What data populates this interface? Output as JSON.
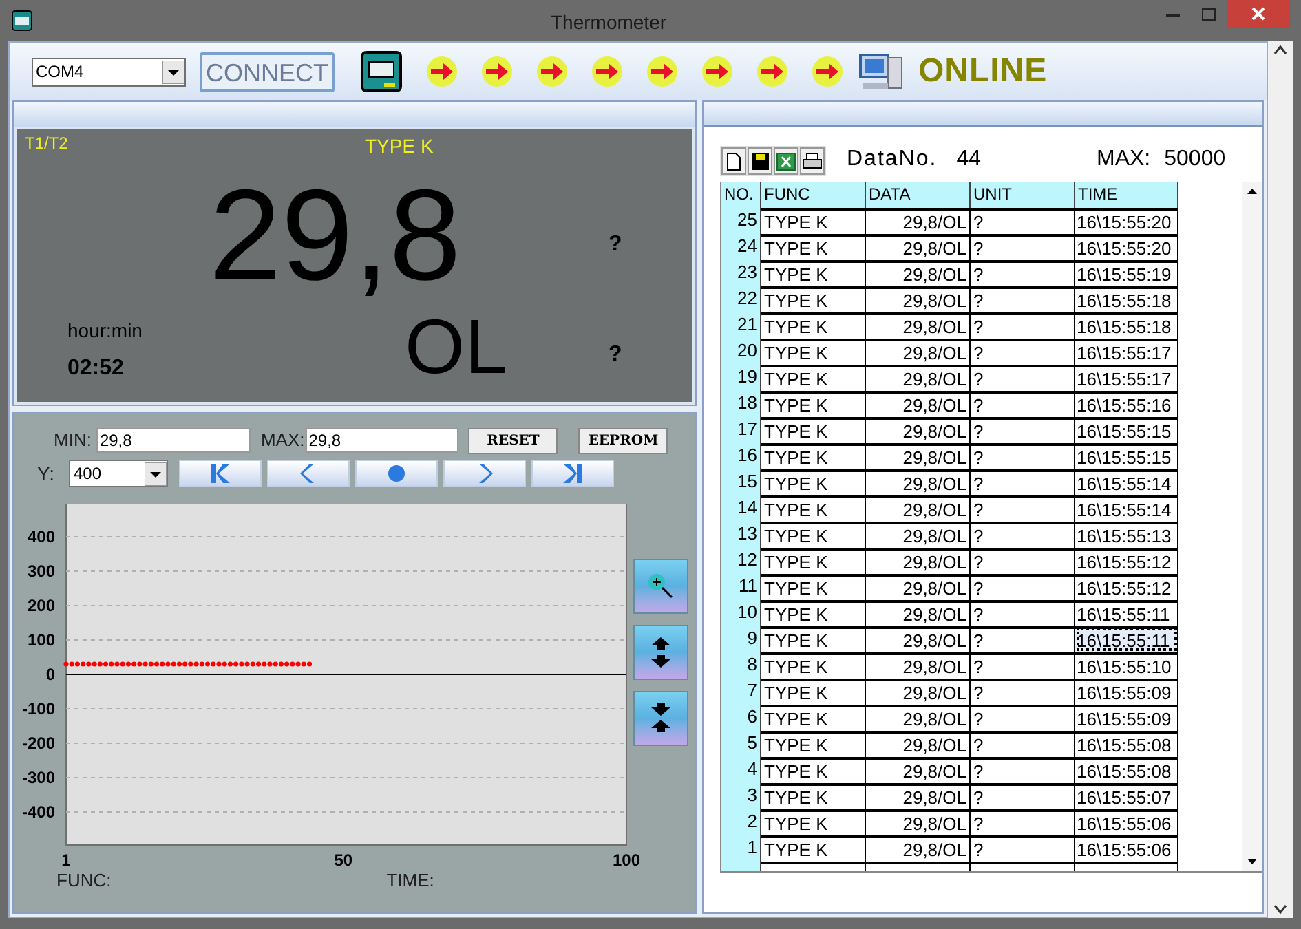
{
  "window": {
    "title": "Thermometer"
  },
  "toolbar": {
    "port": "COM4",
    "connect": "CONNECT",
    "status": "ONLINE"
  },
  "display": {
    "mode": "T1/T2",
    "func": "TYPE K",
    "main_value": "29,8",
    "main_unit": "?",
    "sub_value": "OL",
    "sub_unit": "?",
    "time_label": "hour:min",
    "time": "02:52"
  },
  "graph": {
    "min_label": "MIN:",
    "min": "29,8",
    "max_label": "MAX:",
    "max": "29,8",
    "reset": "RESET",
    "eeprom": "EEPROM",
    "y_label": "Y:",
    "y_range": "400",
    "func_label": "FUNC:",
    "time_label": "TIME:",
    "chart_data": {
      "type": "scatter",
      "grid": true,
      "x": [
        1,
        2,
        3,
        4,
        5,
        6,
        7,
        8,
        9,
        10,
        11,
        12,
        13,
        14,
        15,
        16,
        17,
        18,
        19,
        20,
        21,
        22,
        23,
        24,
        25,
        26,
        27,
        28,
        29,
        30,
        31,
        32,
        33,
        34,
        35,
        36,
        37,
        38,
        39,
        40,
        41,
        42,
        43,
        44
      ],
      "xlim": [
        1,
        100
      ],
      "ylim": [
        -496,
        496
      ],
      "xticks": [
        1,
        50,
        100
      ],
      "yticks": [
        400,
        300,
        200,
        100,
        0,
        -100,
        -200,
        -300,
        -400
      ],
      "series": [
        {
          "color": "#ff0000",
          "values": [
            30,
            30,
            30,
            30,
            30,
            30,
            30,
            30,
            30,
            30,
            30,
            30,
            30,
            30,
            30,
            30,
            30,
            30,
            30,
            30,
            30,
            30,
            30,
            30,
            30,
            30,
            30,
            30,
            30,
            30,
            30,
            30,
            30,
            30,
            30,
            30,
            30,
            30,
            30,
            30,
            30,
            30,
            30,
            30
          ]
        }
      ]
    }
  },
  "data_panel": {
    "data_no_label": "DataNo.",
    "data_no": "44",
    "max_label": "MAX:",
    "max": "50000"
  },
  "table": {
    "columns": [
      "NO.",
      "FUNC",
      "DATA",
      "UNIT",
      "TIME"
    ],
    "rows": [
      {
        "cells": [
          "25",
          "TYPE K",
          "29,8/OL",
          "?",
          "16\\15:55:20"
        ],
        "selected": false
      },
      {
        "cells": [
          "24",
          "TYPE K",
          "29,8/OL",
          "?",
          "16\\15:55:20"
        ],
        "selected": false
      },
      {
        "cells": [
          "23",
          "TYPE K",
          "29,8/OL",
          "?",
          "16\\15:55:19"
        ],
        "selected": false
      },
      {
        "cells": [
          "22",
          "TYPE K",
          "29,8/OL",
          "?",
          "16\\15:55:18"
        ],
        "selected": false
      },
      {
        "cells": [
          "21",
          "TYPE K",
          "29,8/OL",
          "?",
          "16\\15:55:18"
        ],
        "selected": false
      },
      {
        "cells": [
          "20",
          "TYPE K",
          "29,8/OL",
          "?",
          "16\\15:55:17"
        ],
        "selected": false
      },
      {
        "cells": [
          "19",
          "TYPE K",
          "29,8/OL",
          "?",
          "16\\15:55:17"
        ],
        "selected": false
      },
      {
        "cells": [
          "18",
          "TYPE K",
          "29,8/OL",
          "?",
          "16\\15:55:16"
        ],
        "selected": false
      },
      {
        "cells": [
          "17",
          "TYPE K",
          "29,8/OL",
          "?",
          "16\\15:55:15"
        ],
        "selected": false
      },
      {
        "cells": [
          "16",
          "TYPE K",
          "29,8/OL",
          "?",
          "16\\15:55:15"
        ],
        "selected": false
      },
      {
        "cells": [
          "15",
          "TYPE K",
          "29,8/OL",
          "?",
          "16\\15:55:14"
        ],
        "selected": false
      },
      {
        "cells": [
          "14",
          "TYPE K",
          "29,8/OL",
          "?",
          "16\\15:55:14"
        ],
        "selected": false
      },
      {
        "cells": [
          "13",
          "TYPE K",
          "29,8/OL",
          "?",
          "16\\15:55:13"
        ],
        "selected": false
      },
      {
        "cells": [
          "12",
          "TYPE K",
          "29,8/OL",
          "?",
          "16\\15:55:12"
        ],
        "selected": false
      },
      {
        "cells": [
          "11",
          "TYPE K",
          "29,8/OL",
          "?",
          "16\\15:55:12"
        ],
        "selected": false
      },
      {
        "cells": [
          "10",
          "TYPE K",
          "29,8/OL",
          "?",
          "16\\15:55:11"
        ],
        "selected": false
      },
      {
        "cells": [
          "9",
          "TYPE K",
          "29,8/OL",
          "?",
          "16\\15:55:11"
        ],
        "selected": true
      },
      {
        "cells": [
          "8",
          "TYPE K",
          "29,8/OL",
          "?",
          "16\\15:55:10"
        ],
        "selected": false
      },
      {
        "cells": [
          "7",
          "TYPE K",
          "29,8/OL",
          "?",
          "16\\15:55:09"
        ],
        "selected": false
      },
      {
        "cells": [
          "6",
          "TYPE K",
          "29,8/OL",
          "?",
          "16\\15:55:09"
        ],
        "selected": false
      },
      {
        "cells": [
          "5",
          "TYPE K",
          "29,8/OL",
          "?",
          "16\\15:55:08"
        ],
        "selected": false
      },
      {
        "cells": [
          "4",
          "TYPE K",
          "29,8/OL",
          "?",
          "16\\15:55:08"
        ],
        "selected": false
      },
      {
        "cells": [
          "3",
          "TYPE K",
          "29,8/OL",
          "?",
          "16\\15:55:07"
        ],
        "selected": false
      },
      {
        "cells": [
          "2",
          "TYPE K",
          "29,8/OL",
          "?",
          "16\\15:55:06"
        ],
        "selected": false
      },
      {
        "cells": [
          "1",
          "TYPE K",
          "29,8/OL",
          "?",
          "16\\15:55:06"
        ],
        "selected": false
      }
    ]
  }
}
